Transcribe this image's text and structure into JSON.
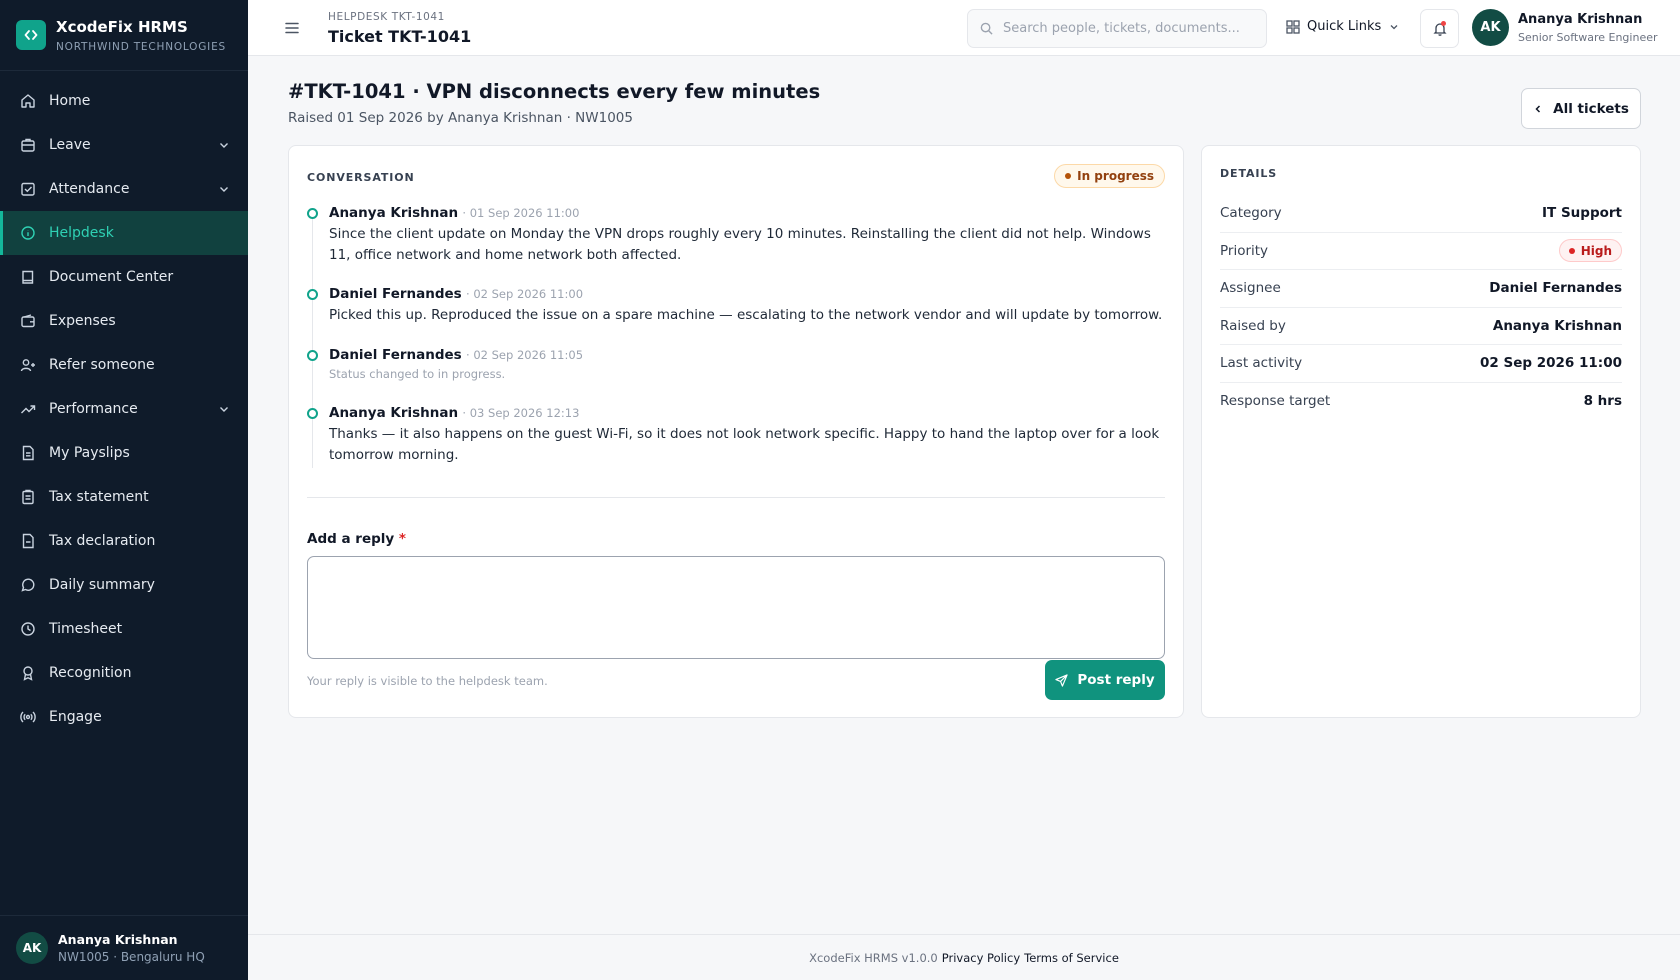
{
  "brand": {
    "name": "XcodeFix HRMS",
    "org": "NORTHWIND TECHNOLOGIES",
    "accent": "#10a38b"
  },
  "sidebar": {
    "items": [
      {
        "label": "Home",
        "icon": "home-icon"
      },
      {
        "label": "Leave",
        "icon": "briefcase-icon",
        "expandable": true
      },
      {
        "label": "Attendance",
        "icon": "calendar-check-icon",
        "expandable": true
      },
      {
        "label": "Helpdesk",
        "icon": "info-circle-icon",
        "active": true
      },
      {
        "label": "Document Center",
        "icon": "book-icon"
      },
      {
        "label": "Expenses",
        "icon": "wallet-icon"
      },
      {
        "label": "Refer someone",
        "icon": "user-plus-icon"
      },
      {
        "label": "Performance",
        "icon": "trending-up-icon",
        "expandable": true
      },
      {
        "label": "My Payslips",
        "icon": "file-text-icon"
      },
      {
        "label": "Tax statement",
        "icon": "clipboard-icon"
      },
      {
        "label": "Tax declaration",
        "icon": "file-icon"
      },
      {
        "label": "Daily summary",
        "icon": "message-circle-icon"
      },
      {
        "label": "Timesheet",
        "icon": "clock-icon"
      },
      {
        "label": "Recognition",
        "icon": "award-icon"
      },
      {
        "label": "Engage",
        "icon": "radio-icon"
      }
    ],
    "user": {
      "initials": "AK",
      "name": "Ananya Krishnan",
      "sub": "NW1005 · Bengaluru HQ"
    }
  },
  "topbar": {
    "crumb": "HELPDESK TKT-1041",
    "title": "Ticket TKT-1041",
    "search_placeholder": "Search people, tickets, documents...",
    "quick_links": "Quick Links",
    "user": {
      "initials": "AK",
      "name": "Ananya Krishnan",
      "role": "Senior Software Engineer"
    }
  },
  "ticket": {
    "title": "#TKT-1041 · VPN disconnects every few minutes",
    "subtitle": "Raised 01 Sep 2026 by Ananya Krishnan · NW1005",
    "all_tickets": "All tickets"
  },
  "conversation": {
    "label": "CONVERSATION",
    "status": "In progress",
    "entries": [
      {
        "author": "Ananya Krishnan",
        "time": "· 01 Sep 2026 11:00",
        "body": "Since the client update on Monday the VPN drops roughly every 10 minutes. Reinstalling the client did not help. Windows 11, office network and home network both affected.",
        "note": ""
      },
      {
        "author": "Daniel Fernandes",
        "time": "· 02 Sep 2026 11:00",
        "body": "Picked this up. Reproduced the issue on a spare machine — escalating to the network vendor and will update by tomorrow.",
        "note": ""
      },
      {
        "author": "Daniel Fernandes",
        "time": "· 02 Sep 2026 11:05",
        "body": "",
        "note": "Status changed to in progress."
      },
      {
        "author": "Ananya Krishnan",
        "time": "· 03 Sep 2026 12:13",
        "body": "Thanks — it also happens on the guest Wi-Fi, so it does not look network specific. Happy to hand the laptop over for a look tomorrow morning.",
        "note": ""
      }
    ],
    "reply_label": "Add a reply",
    "required_mark": "*",
    "reply_value": "",
    "reply_help": "Your reply is visible to the helpdesk team.",
    "post_label": "Post reply"
  },
  "details": {
    "label": "DETAILS",
    "rows": [
      {
        "key": "Category",
        "value": "IT Support"
      },
      {
        "key": "Priority",
        "value": "High"
      },
      {
        "key": "Assignee",
        "value": "Daniel Fernandes"
      },
      {
        "key": "Raised by",
        "value": "Ananya Krishnan"
      },
      {
        "key": "Last activity",
        "value": "02 Sep 2026 11:00"
      },
      {
        "key": "Response target",
        "value": "8 hrs"
      }
    ]
  },
  "footer": {
    "version": "XcodeFix HRMS v1.0.0",
    "privacy": "Privacy Policy",
    "terms": "Terms of Service"
  },
  "colors": {
    "sidebar_bg": "#0f1b2a",
    "accent": "#10a38b",
    "status_in_progress": "#92400e",
    "priority_high": "#b91c1c"
  }
}
